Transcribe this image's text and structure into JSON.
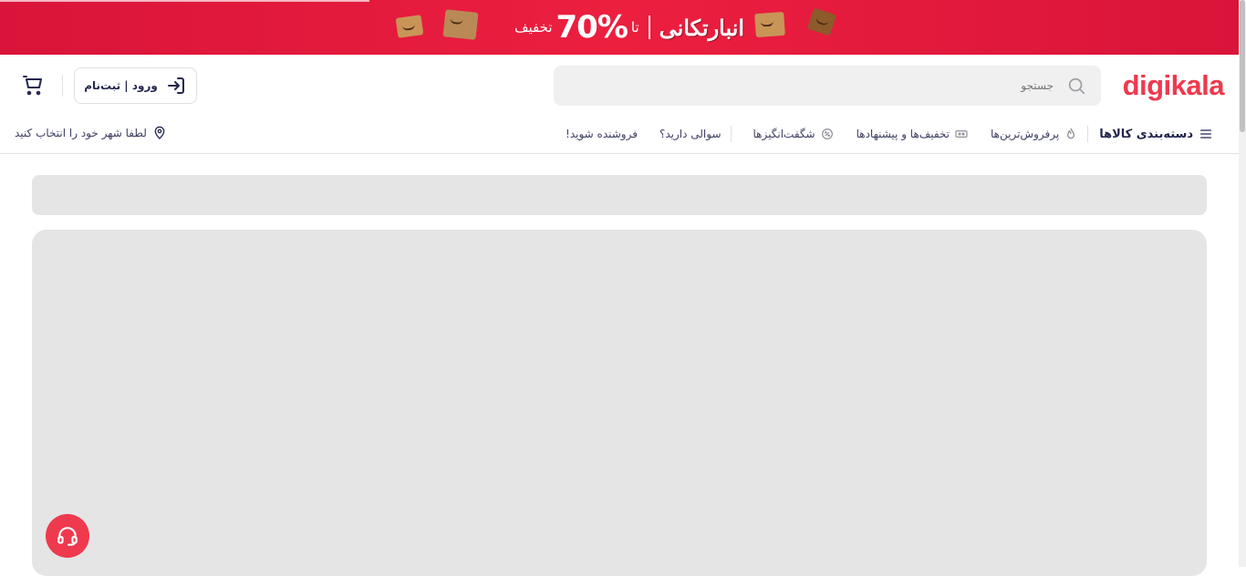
{
  "banner": {
    "discount_label": "تخفیف",
    "percent": "70%",
    "upto": "تا",
    "campaign_name": "انبارتکانی"
  },
  "header": {
    "logo": "digikala",
    "search_placeholder": "جستجو",
    "login_label": "ورود | ثبت‌نام"
  },
  "nav": {
    "categories": "دسته‌بندی کالاها",
    "items": [
      "پرفروش‌ترین‌ها",
      "تخفیف‌ها و پیشنهادها",
      "شگفت‌انگیزها",
      "سوالی دارید؟",
      "فروشنده شوید!"
    ],
    "city_prompt": "لطفا شهر خود را انتخاب کنید"
  },
  "colors": {
    "brand": "#ef394e",
    "skeleton": "#e5e5e5"
  }
}
